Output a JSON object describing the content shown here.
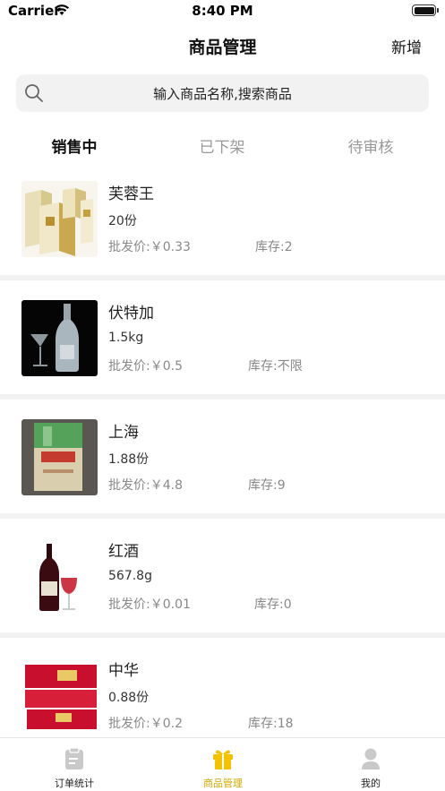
{
  "status_bar": {
    "carrier": "Carrier",
    "time": "8:40 PM"
  },
  "nav": {
    "title": "商品管理",
    "action": "新增"
  },
  "search": {
    "placeholder": "输入商品名称,搜索商品"
  },
  "tabs": [
    {
      "label": "销售中",
      "active": true
    },
    {
      "label": "已下架",
      "active": false
    },
    {
      "label": "待审核",
      "active": false
    }
  ],
  "products": [
    {
      "name": "芙蓉王",
      "spec": "20份",
      "price": "批发价:￥0.33",
      "stock": "库存:2",
      "thumb": "cigarette-box-gold"
    },
    {
      "name": "伏特加",
      "spec": "1.5kg",
      "price": "批发价:￥0.5",
      "stock": "库存:不限",
      "thumb": "vodka-bottle"
    },
    {
      "name": "上海",
      "spec": "1.88份",
      "price": "批发价:￥4.8",
      "stock": "库存:9",
      "thumb": "cigarette-pack-green"
    },
    {
      "name": "红酒",
      "spec": "567.8g",
      "price": "批发价:￥0.01",
      "stock": "库存:0",
      "thumb": "red-wine-bottle"
    },
    {
      "name": "中华",
      "spec": "0.88份",
      "price": "批发价:￥0.2",
      "stock": "库存:18",
      "thumb": "cigarette-carton-red"
    }
  ],
  "tab_bar": [
    {
      "label": "订单统计",
      "icon": "clipboard-icon",
      "active": false
    },
    {
      "label": "商品管理",
      "icon": "gift-icon",
      "active": true,
      "color": "#F2C200"
    },
    {
      "label": "我的",
      "icon": "person-icon",
      "active": false
    }
  ],
  "colors": {
    "accent": "#F2C200",
    "separator": "#F2F2F2",
    "search_bg": "#F2F2F2"
  }
}
